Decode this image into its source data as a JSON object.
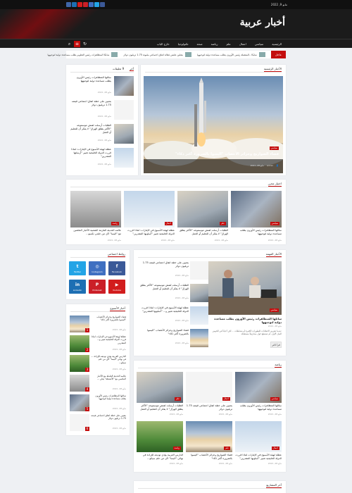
{
  "topbar": {
    "date": "مايو 9, 2022",
    "socials": [
      {
        "icon": "vk-icon",
        "color": "#3f66a8"
      },
      {
        "icon": "linkedin-icon",
        "color": "#1d6fb3"
      },
      {
        "icon": "youtube-icon",
        "color": "#d21d1d"
      },
      {
        "icon": "pinterest-icon",
        "color": "#cb1f27"
      },
      {
        "icon": "instagram-icon",
        "color": "#3f6fc1"
      },
      {
        "icon": "twitter-icon",
        "color": "#23a4e6"
      },
      {
        "icon": "facebook-icon",
        "color": "#3b5998"
      }
    ]
  },
  "site": {
    "logo": "أخبار عربية",
    "accent": "#c40d0d"
  },
  "nav": {
    "items": [
      "الرئيسية",
      "سياسي",
      "اعمال",
      "علم",
      "رياضة",
      "صحة",
      "تكنولوجيا",
      "خارج الباب"
    ]
  },
  "ticker": {
    "label": "عاجل",
    "items": [
      "شابكا ..المفصلة رئيس الأوزون يطلب مساعدة دولية لتوجيهها",
      "بتعلين علنش فعالة اتفاق اجتماعي مليونة 1.75 تريليون دولار",
      "شابكا المتظاهرات رئيس التطوير يطلب مساعدة دولية لتوجيهها"
    ]
  },
  "hero": {
    "section_title": "الأخبار الرئيسية",
    "category": "سياسي",
    "headline": "فضاء الصواريخ وجزائر الأعصاب \"اليسوا بالضرورة أكثر ذكاء\"",
    "author": "admin",
    "date": "مايو 28, 2021"
  },
  "latest": {
    "title": "آخر",
    "tab2": "9 تعليقات",
    "items": [
      {
        "text": "سائلها المتظاهرات رئيس الأوزون يطلب مساعدة دولية لتوجيهها",
        "date": "مايو 28, 2021"
      },
      {
        "text": "بتعيين على خطة اتفاق اجتماعي قيمته 1.75 تريليون دولار",
        "date": "مايو 28, 2021"
      },
      {
        "text": "الطلبات أرسلت لفتش موسموعه \"الأكثر يطلق الهرال\" لا يفكر أن للتعليم أو العمل",
        "date": "مايو 28, 2021"
      },
      {
        "text": "عطلة لهيئة الأسبوع في الإمارات: لماذا قررت الدولة الخليجية تغيير \"أرسلتها المقدرين\"",
        "date": "مايو 28, 2021"
      }
    ]
  },
  "editor": {
    "title": "اختيار محرر",
    "items": [
      {
        "text": "سائلها المتظاهرات رئيس الأوزون يطلب مساعدة دولية لتوجيهها",
        "date": "مايو 28, 2021",
        "cat": "سياسي"
      },
      {
        "text": "الطلبات أرسلت لفتش موسموعه \"الأكثر يطلق الهرال\" لا يفكر أن للتعليم أو العمل",
        "date": "مايو 28, 2021",
        "cat": "علم"
      },
      {
        "text": "عطلة لهيئة الأسبوع في الإمارات: لماذا قررت الدولة الخليجية تغيير \"أسلوبها المقدرين\"",
        "date": "مايو 28, 2021",
        "cat": "اعمال"
      },
      {
        "text": "عالمه الحديثة الفارمة الشعبية الأخبار الملثمين مع \"اليسا\" لأي من حلمي نكسو...",
        "date": "مايو 28, 2021",
        "cat": "رياضة"
      }
    ]
  },
  "social": {
    "title": "روابط اجتماعي",
    "items": [
      {
        "label": "Facebook",
        "icon": "facebook-icon",
        "color": "#3b5998",
        "glyph": "f"
      },
      {
        "label": "Instagram",
        "icon": "instagram-icon",
        "color": "#3f6fc1",
        "glyph": "◎"
      },
      {
        "label": "Twitter",
        "icon": "twitter-icon",
        "color": "#23a4e6",
        "glyph": "t"
      },
      {
        "label": "Youtube",
        "icon": "youtube-icon",
        "color": "#d21d1d",
        "glyph": "▶"
      },
      {
        "label": "Pinterest",
        "icon": "pinterest-icon",
        "color": "#cb1f27",
        "glyph": "P"
      },
      {
        "label": "Linkedin",
        "icon": "linkedin-icon",
        "color": "#1d6fb3",
        "glyph": "in"
      }
    ]
  },
  "popular": {
    "title": "الأخبار المهمة",
    "main": {
      "cat": "سياسي",
      "headline": "سائلها المتظاهرات رئيس الأوزون يطلب مساعدة دولية لتوجيهها",
      "date": "مايو 28, 2021",
      "excerpt": "عندما تتعرض الانتقادات للتطورات الكثيرة أو بتشاطات ... لكن أحياناً في الخوض البيان الأول، لم تستطع حول مشاريعاً مستعجلة",
      "button": "قرأ اكثر"
    },
    "items": [
      {
        "text": "بتعيين على خطة اتفاق اجتماعي قيمته 1.75 تريليون دولار",
        "date": "مايو 28, 2021"
      },
      {
        "text": "الطلبات أرسلت لفتش موسموعه \"الأكثر يطلق الهرال\" لا يفكر أن للتعليم أو العمل",
        "date": "مايو 28, 2021"
      },
      {
        "text": "عطلة لهيئة الأسبوع في الإمارات: لماذا قررت الدولة الخليجية تغيير و... \"أسلوبها المقدرين\"",
        "date": "مايو 28, 2021"
      },
      {
        "text": "فضاء الصواريخ وجزائر الأعصاب \"اليسوا بالضرورة أكثر ذكاء\"",
        "date": "مايو 28, 2021"
      }
    ]
  },
  "trending": {
    "title": "أخبار الأسبوع",
    "items": [
      {
        "text": "فضاء الصواريخ وجزائر الأعصاب \"اليسوا بالضرورة أكثر ذكاء\"",
        "date": "مايو 28, 2021",
        "n": "1"
      },
      {
        "text": "عطلة لهيئة الأسبوع في الإمارات لماذا قررت الدولة الخليجية تغيير و... المقدرين",
        "date": "مايو 28, 2021",
        "n": "2"
      },
      {
        "text": "الدارس العربية يؤدي توديعه للإرادة ... في نهائي \"اليسا\" لأي من حلم سيكو...",
        "date": "مايو 28, 2021",
        "n": "3"
      },
      {
        "text": "عالمه الحديثة العاملة مع الأخبار الملثمين مع \"الأنشطة\" يعلن ...",
        "date": "مايو 28, 2021",
        "n": "4"
      },
      {
        "text": "سائلها المتظاهرات رئيس الأوزون يطلب مساعدة دولية لتوجيهها",
        "date": "مايو 28, 2021",
        "n": "5"
      },
      {
        "text": "بتعيين على خطة اتفاق اجتماعي قيمته 1.75 تريليون دولار",
        "date": "مايو 28, 2021",
        "n": "6"
      }
    ]
  },
  "grid": {
    "title": "رياضة",
    "items": [
      {
        "text": "سائلها المتظاهرات رئيس الأوزون يطلب مساعدة دولية لتوجيهها",
        "date": "مايو 28, 2021",
        "cat": "سياسي"
      },
      {
        "text": "بتعيين على خطة اتفاق اجتماعي قيمته 1.75 تريليون دولار",
        "date": "مايو 28, 2021",
        "cat": "اعمال"
      },
      {
        "text": "الطلبات أرسلت لفتش موسموعه \"الأكثر يطلق الهرال\" لا يفكر أن للتعليم أو العمل",
        "date": "مايو 28, 2021",
        "cat": "علم"
      },
      {
        "text": "عطلة لهيئة الأسبوع في الإمارات لماذا قررت الدولة الخليجية تغيير \"أسلوبها المقدرين\"",
        "date": "مايو 28, 2021",
        "cat": "اعمال"
      },
      {
        "text": "فضاء الصواريخ وجزائر الأعصاب \"اليسوا بالضرورة أكثر ذكاء\"",
        "date": "مايو 28, 2021",
        "cat": "علم"
      },
      {
        "text": "الدارس العربية يؤدي توديعه للإرادة في نهائي \"اليسا\" لأي من حلم سيكو...",
        "date": "مايو 28, 2021",
        "cat": "رياضة"
      }
    ]
  },
  "bottom": {
    "title": "آخر المشاريع"
  }
}
